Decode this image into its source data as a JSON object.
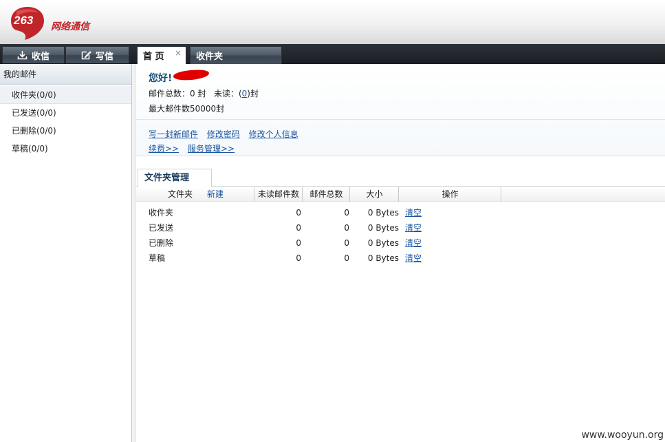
{
  "header": {
    "logo_number": "263",
    "logo_text": "网络通信"
  },
  "toolbar": {
    "receive_label": "收信",
    "compose_label": "写信"
  },
  "tabs": [
    {
      "label": "首 页",
      "active": true,
      "close": "×"
    },
    {
      "label": "收件夹",
      "active": false
    }
  ],
  "sidebar": {
    "title": "我的邮件",
    "items": [
      {
        "label": "收件夹(0/0)"
      },
      {
        "label": "已发送(0/0)"
      },
      {
        "label": "已删除(0/0)"
      },
      {
        "label": "草稿(0/0)"
      }
    ]
  },
  "welcome": {
    "greeting": "您好!",
    "total_label": "邮件总数：",
    "total_value": "0",
    "unit_feng": "封",
    "unread_label": "未读：(",
    "unread_value": "0",
    "unread_suffix": ")封",
    "max_label": "最大邮件数50000封",
    "links": {
      "compose": "写一封新邮件",
      "change_password": "修改密码",
      "edit_profile": "修改个人信息",
      "renew": "续费>>",
      "service": "服务管理>>"
    }
  },
  "folder_mgmt": {
    "tab_label": "文件夹管理",
    "columns": {
      "folder": "文件夹",
      "new": "新建",
      "unread": "未读邮件数",
      "total": "邮件总数",
      "size": "大小",
      "action": "操作"
    },
    "rows": [
      {
        "name": "收件夹",
        "unread": "0",
        "total": "0",
        "size": "0 Bytes",
        "action": "清空"
      },
      {
        "name": "已发送",
        "unread": "0",
        "total": "0",
        "size": "0 Bytes",
        "action": "清空"
      },
      {
        "name": "已删除",
        "unread": "0",
        "total": "0",
        "size": "0 Bytes",
        "action": "清空"
      },
      {
        "name": "草稿",
        "unread": "0",
        "total": "0",
        "size": "0 Bytes",
        "action": "清空"
      }
    ]
  },
  "watermark": "www.wooyun.org",
  "colors": {
    "brand_red": "#c0252a",
    "link_blue": "#1a55a0",
    "tabbar_dark": "#1b1f24"
  }
}
